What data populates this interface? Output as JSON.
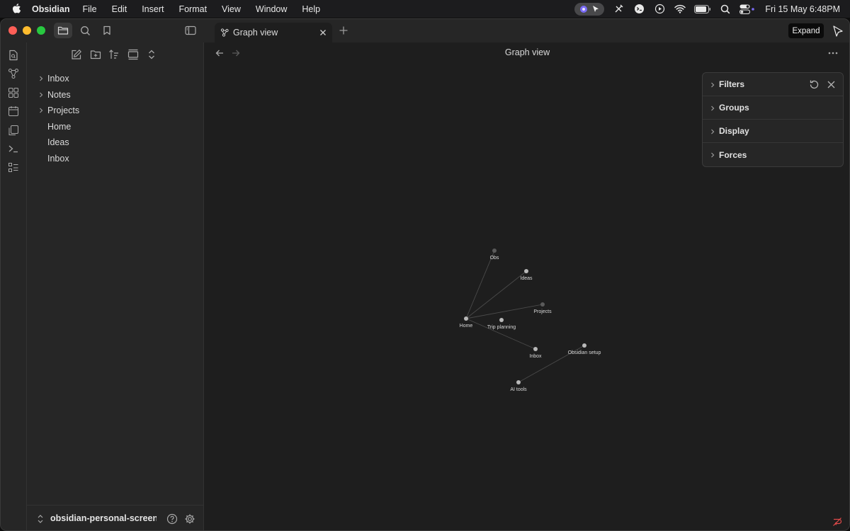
{
  "menubar": {
    "app_name": "Obsidian",
    "menus": [
      "File",
      "Edit",
      "Insert",
      "Format",
      "View",
      "Window",
      "Help"
    ],
    "clock": "Fri 15 May  6:48PM"
  },
  "tabs": [
    {
      "label": "Graph view"
    }
  ],
  "tooltip": {
    "expand": "Expand"
  },
  "explorer": {
    "items": [
      {
        "label": "Inbox",
        "folder": true
      },
      {
        "label": "Notes",
        "folder": true
      },
      {
        "label": "Projects",
        "folder": true
      },
      {
        "label": "Home",
        "folder": false
      },
      {
        "label": "Ideas",
        "folder": false
      },
      {
        "label": "Inbox",
        "folder": false
      }
    ],
    "vault_name": "obsidian-personal-screens..."
  },
  "main": {
    "title": "Graph view"
  },
  "graph_panel": {
    "sections": [
      "Filters",
      "Groups",
      "Display",
      "Forces"
    ]
  },
  "graph": {
    "nodes": [
      {
        "id": "obs",
        "label": "Obs",
        "dim": true
      },
      {
        "id": "ideas",
        "label": "Ideas",
        "dim": false
      },
      {
        "id": "projects",
        "label": "Projects",
        "dim": true
      },
      {
        "id": "home",
        "label": "Home",
        "dim": false
      },
      {
        "id": "trip",
        "label": "Trip planning",
        "dim": false
      },
      {
        "id": "inbox",
        "label": "Inbox",
        "dim": false
      },
      {
        "id": "setup",
        "label": "Obsidian setup",
        "dim": false
      },
      {
        "id": "ai",
        "label": "AI tools",
        "dim": false
      }
    ],
    "edges": [
      [
        "home",
        "obs"
      ],
      [
        "home",
        "ideas"
      ],
      [
        "home",
        "projects"
      ],
      [
        "home",
        "inbox"
      ],
      [
        "ai",
        "setup"
      ]
    ]
  }
}
